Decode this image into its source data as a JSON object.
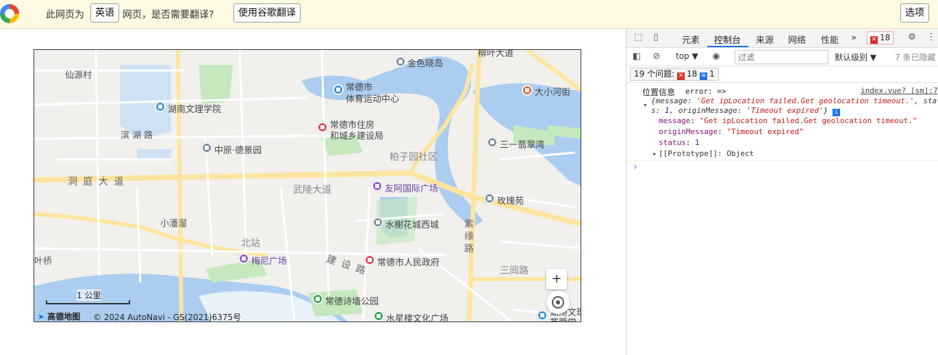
{
  "translate_bar": {
    "prefix": "此网页为",
    "language": "英语",
    "question": "网页，是否需要翻译?",
    "translate_button": "使用谷歌翻译",
    "options_button": "选项"
  },
  "map": {
    "labels": {
      "xianyuan": "仙源村",
      "jinseshiao": "金色晓岛",
      "liuye": "柳叶大道",
      "changde_sports": "常德市",
      "changde_sports2": "体育运动中心",
      "daxiaohe": "大小河街",
      "hunan_wenli": "湖南文理学院",
      "zhufang1": "常德市住房",
      "zhufang2": "和城乡建设局",
      "binhu": "滨 湖 路",
      "zhongyuan": "中原·德景园",
      "boziyuan": "柏子园社区",
      "sanyi": "三一翡翠湾",
      "dongting": "洞 庭 大 道",
      "wuling": "武陵大道",
      "youa": "友阿国际广场",
      "meigui": "玫瑰苑",
      "xiaopan": "小潘溜",
      "shuixie": "水榭花城西城",
      "ziyuan": "紫\n缘\n路",
      "beizhan": "北站",
      "yeqiao": "叶桥",
      "meini": "梅尼广场",
      "jianshe": "建 设 路",
      "renmin": "常德市人民政府",
      "sanlv": "三闾路",
      "shiqiang": "常德诗墙公园",
      "shuixinglou": "水星楼文化广场",
      "hunanwenli2": "湖南文理",
      "furong": "芙蓉学"
    },
    "zoom_in": "+",
    "scale": "1 公里",
    "logo": "高德地图",
    "copyright": "© 2024 AutoNavi - GS(2021)6375号"
  },
  "devtools": {
    "tabs": [
      "元素",
      "控制台",
      "来源",
      "网络",
      "性能"
    ],
    "active_tab": "控制台",
    "more_tabs": "»",
    "error_count": "18",
    "context": "top ▼",
    "filter_placeholder": "过滤",
    "level": "默认级别 ▼",
    "hidden": "7 条已隐藏",
    "issues_label": "19 个问题:",
    "issues_errors": "18",
    "issues_messages": "1",
    "console": {
      "label": "位置信息",
      "prefix": "error: =>",
      "source_link": "index.vue? [sm]:7",
      "summary_1a": "{message: ",
      "summary_1b": "'Get ipLocation failed.Get geolocation timeout.'",
      "summary_1c": ", stat",
      "summary_2a": "s: ",
      "summary_2b": "1",
      "summary_2c": ", originMessage: ",
      "summary_2d": "'Timeout expired'",
      "summary_2e": "}",
      "message_key": "message",
      "message_val": "\"Get ipLocation failed.Get geolocation timeout.\"",
      "origin_key": "originMessage",
      "origin_val": "\"Timeout expired\"",
      "status_key": "status",
      "status_val": "1",
      "proto": "[[Prototype]]: Object"
    }
  }
}
